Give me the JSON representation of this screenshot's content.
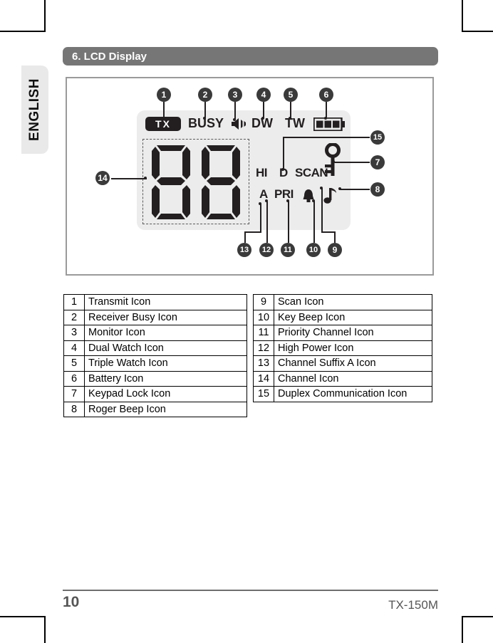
{
  "page": {
    "language_tab": "ENGLISH",
    "section_title": "6. LCD Display",
    "page_number": "10",
    "model": "TX-150M"
  },
  "lcd": {
    "transmit_label": "TX",
    "busy_label": "BUSY",
    "monitor_icon": "speaker-icon",
    "dual_watch_label": "DW",
    "triple_watch_label": "TW",
    "battery_icon": "battery-icon",
    "battery_bars": 3,
    "digits": "88",
    "high_power_label": "HI",
    "duplex_label": "D",
    "scan_label": "SCAN",
    "suffix_a_label": "A",
    "priority_label": "PRI",
    "key_icon": "key-icon",
    "bell_icon": "bell-icon",
    "note_icon": "music-note-icon"
  },
  "callouts": [
    {
      "n": "1"
    },
    {
      "n": "2"
    },
    {
      "n": "3"
    },
    {
      "n": "4"
    },
    {
      "n": "5"
    },
    {
      "n": "6"
    },
    {
      "n": "7"
    },
    {
      "n": "8"
    },
    {
      "n": "9"
    },
    {
      "n": "10"
    },
    {
      "n": "11"
    },
    {
      "n": "12"
    },
    {
      "n": "13"
    },
    {
      "n": "14"
    },
    {
      "n": "15"
    }
  ],
  "legend_left": [
    {
      "num": "1",
      "label": "Transmit Icon"
    },
    {
      "num": "2",
      "label": "Receiver Busy Icon"
    },
    {
      "num": "3",
      "label": "Monitor Icon"
    },
    {
      "num": "4",
      "label": "Dual Watch Icon"
    },
    {
      "num": "5",
      "label": "Triple Watch Icon"
    },
    {
      "num": "6",
      "label": "Battery Icon"
    },
    {
      "num": "7",
      "label": "Keypad Lock Icon"
    },
    {
      "num": "8",
      "label": "Roger Beep Icon"
    }
  ],
  "legend_right": [
    {
      "num": "9",
      "label": "Scan Icon"
    },
    {
      "num": "10",
      "label": "Key Beep Icon"
    },
    {
      "num": "11",
      "label": "Priority Channel Icon"
    },
    {
      "num": "12",
      "label": "High Power Icon"
    },
    {
      "num": "13",
      "label": "Channel Suffix A Icon"
    },
    {
      "num": "14",
      "label": "Channel Icon"
    },
    {
      "num": "15",
      "label": "Duplex Communication Icon"
    }
  ],
  "colors": {
    "header_bar": "#767676",
    "lcd_background": "#ececec",
    "lcd_ink": "#231f20",
    "callout_fill": "#3a3a3a",
    "frame_border": "#9a9a9a",
    "footer_text": "#555555"
  }
}
